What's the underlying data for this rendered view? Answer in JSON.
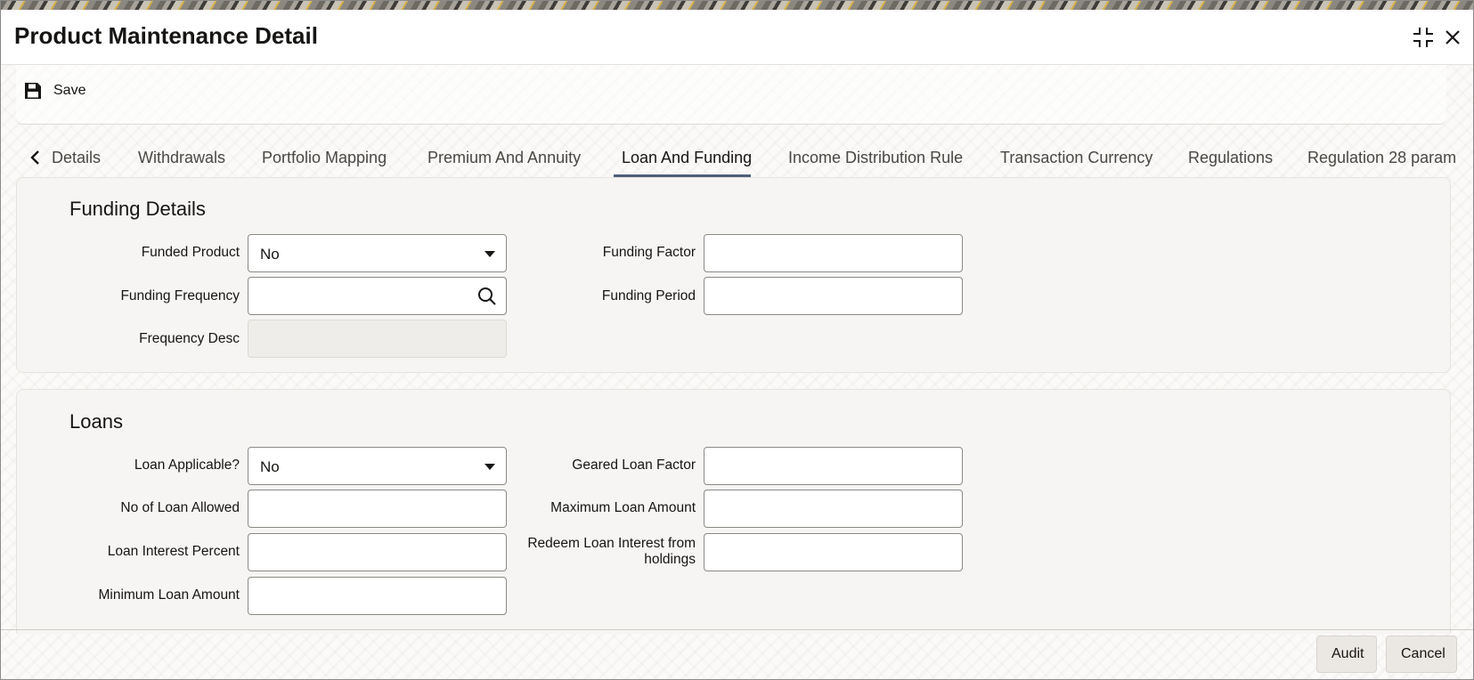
{
  "window": {
    "title": "Product Maintenance Detail"
  },
  "toolbar": {
    "save_label": "Save"
  },
  "tabs": [
    {
      "label": "Details"
    },
    {
      "label": "Withdrawals"
    },
    {
      "label": "Portfolio Mapping"
    },
    {
      "label": "Premium And Annuity"
    },
    {
      "label": "Loan And Funding"
    },
    {
      "label": "Income Distribution Rule"
    },
    {
      "label": "Transaction Currency"
    },
    {
      "label": "Regulations"
    },
    {
      "label": "Regulation 28 param"
    }
  ],
  "active_tab": "Loan And Funding",
  "funding": {
    "title": "Funding Details",
    "funded_product": {
      "label": "Funded Product",
      "value": "No"
    },
    "funding_factor": {
      "label": "Funding Factor",
      "value": ""
    },
    "funding_frequency": {
      "label": "Funding Frequency",
      "value": ""
    },
    "funding_period": {
      "label": "Funding Period",
      "value": ""
    },
    "frequency_desc": {
      "label": "Frequency Desc",
      "value": ""
    }
  },
  "loans": {
    "title": "Loans",
    "loan_applicable": {
      "label": "Loan Applicable?",
      "value": "No"
    },
    "geared_loan_factor": {
      "label": "Geared Loan Factor",
      "value": ""
    },
    "no_of_loan_allowed": {
      "label": "No of Loan Allowed",
      "value": ""
    },
    "maximum_loan_amount": {
      "label": "Maximum Loan Amount",
      "value": ""
    },
    "loan_interest_percent": {
      "label": "Loan Interest Percent",
      "value": ""
    },
    "redeem_loan_interest": {
      "label_line1": "Redeem Loan Interest from",
      "label_line2": "holdings",
      "value": ""
    },
    "minimum_loan_amount": {
      "label": "Minimum Loan Amount",
      "value": ""
    }
  },
  "footer": {
    "audit_label": "Audit",
    "cancel_label": "Cancel"
  },
  "colors": {
    "active_tab_underline": "#4f5e79",
    "panel_bg": "#f6f5f3",
    "button_bg": "#ebe8e4"
  },
  "icons": [
    "save-icon",
    "maximize-icon",
    "close-icon",
    "chevron-left-icon",
    "search-icon",
    "dropdown-caret-icon"
  ]
}
